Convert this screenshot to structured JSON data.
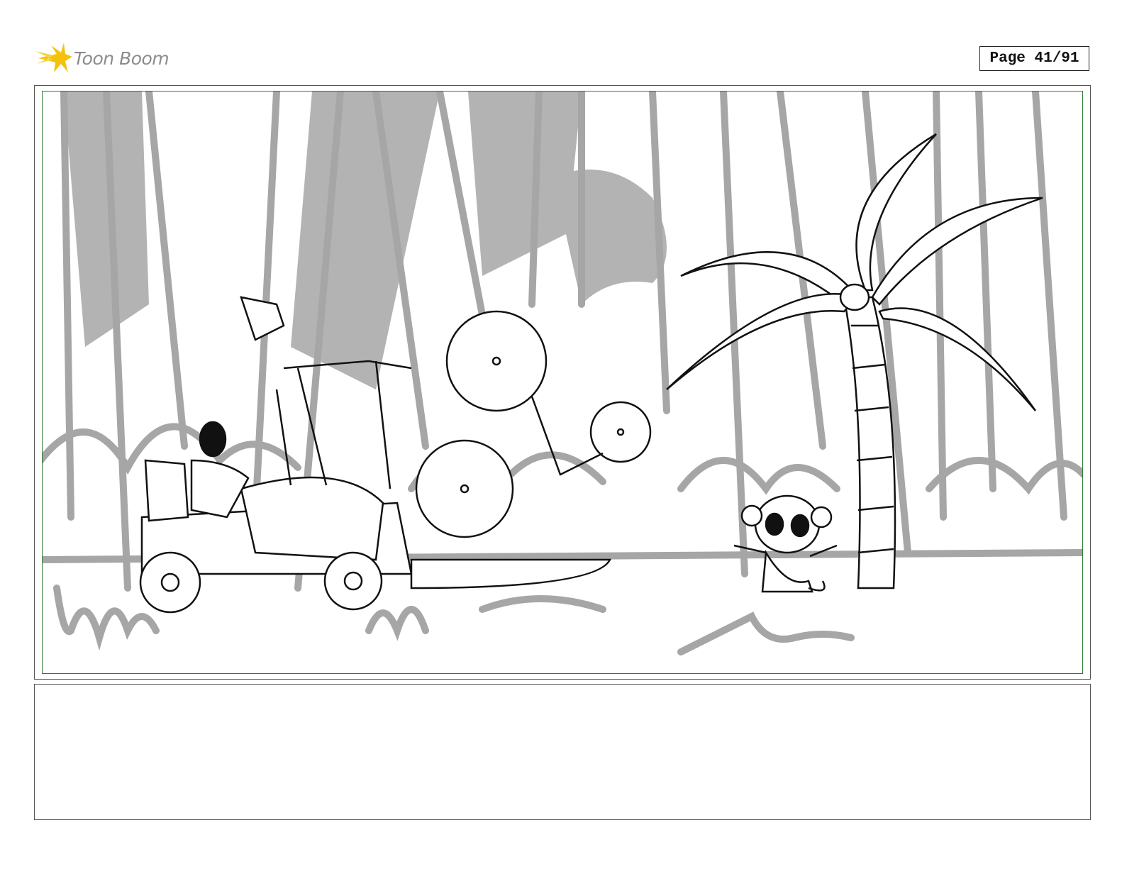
{
  "header": {
    "brand": "Toon Boom",
    "page_label": "Page 41/91"
  },
  "panel": {
    "description_shown": false,
    "safe_frame_color": "#2e7d32",
    "background_sketch_color": "#a6a6a6",
    "ink_color": "#111111"
  },
  "notes": {
    "text": ""
  },
  "icons": {
    "logo": "comet-star-logo-icon"
  },
  "colors": {
    "logo_yellow": "#f4c20d",
    "logo_text": "#8c8c8c"
  }
}
